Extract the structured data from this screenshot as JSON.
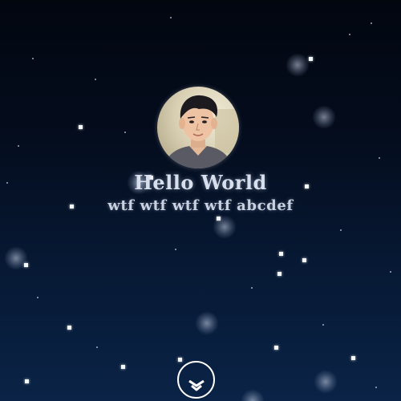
{
  "profile": {
    "avatar_icon": "profile-photo",
    "title": "Hello World",
    "subtitle": "wtf wtf wtf wtf abcdef"
  },
  "controls": {
    "scroll_down_icon": "double-chevron-down-icon"
  },
  "colors": {
    "background_top": "#02060f",
    "background_bottom": "#0a2346",
    "text": "#d8dfec",
    "star": "#f4f8ff"
  }
}
